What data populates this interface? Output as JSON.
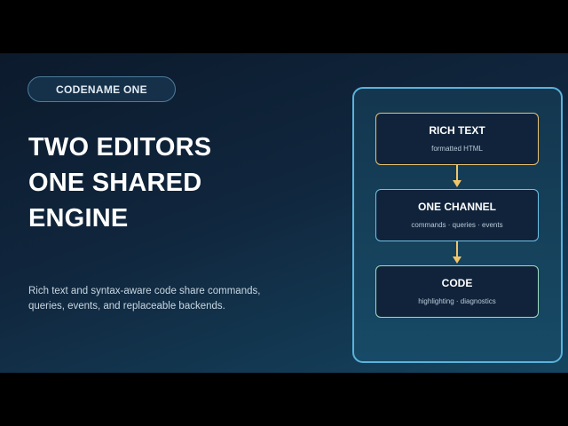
{
  "slide": {
    "badge": "CODENAME ONE",
    "headline": [
      "TWO EDITORS",
      "ONE SHARED",
      "ENGINE"
    ],
    "description": [
      "Rich text and syntax-aware code share commands,",
      "queries, events, and replaceable backends."
    ]
  },
  "diagram": {
    "nodes": [
      {
        "title": "RICH TEXT",
        "subtitle": "formatted HTML",
        "border_color": "#e8c172"
      },
      {
        "title": "ONE CHANNEL",
        "subtitle": "commands · queries · events",
        "border_color": "#6cc2e8"
      },
      {
        "title": "CODE",
        "subtitle": "highlighting · diagnostics",
        "border_color": "#9fdcc0"
      }
    ],
    "arrow_color": "#f0c66a",
    "panel_border_color": "#5ab2dc"
  }
}
